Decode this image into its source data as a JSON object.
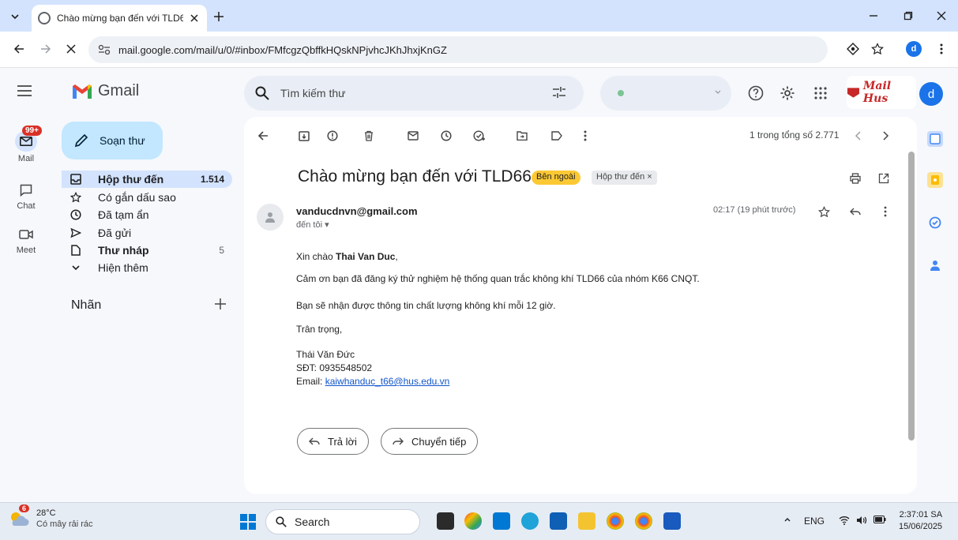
{
  "browser": {
    "tab_title": "Chào mừng bạn đến với TLD66",
    "url": "mail.google.com/mail/u/0/#inbox/FMfcgzQbffkHQskNPjvhcJKhJhxjKnGZ",
    "profile_initial": "d"
  },
  "gmail": {
    "logo_text": "Gmail",
    "search_placeholder": "Tìm kiếm thư",
    "brand_label": "Mail Hus",
    "avatar_initial": "d"
  },
  "rail": {
    "mail_badge": "99+",
    "items": [
      {
        "label": "Mail",
        "icon": "mail-icon"
      },
      {
        "label": "Chat",
        "icon": "chat-icon"
      },
      {
        "label": "Meet",
        "icon": "video-icon"
      }
    ]
  },
  "nav": {
    "compose_label": "Soạn thư",
    "items": [
      {
        "label": "Hộp thư đến",
        "count": "1.514",
        "icon": "inbox-icon"
      },
      {
        "label": "Có gắn dấu sao",
        "count": "",
        "icon": "star-icon"
      },
      {
        "label": "Đã tạm ẩn",
        "count": "",
        "icon": "clock-icon"
      },
      {
        "label": "Đã gửi",
        "count": "",
        "icon": "send-icon"
      },
      {
        "label": "Thư nháp",
        "count": "5",
        "icon": "draft-icon"
      },
      {
        "label": "Hiện thêm",
        "count": "",
        "icon": "chevron-down-icon"
      }
    ],
    "labels_header": "Nhãn"
  },
  "message": {
    "pager": "1 trong tổng số 2.771",
    "subject": "Chào mừng bạn đến với TLD66",
    "chip_outside": "Bên ngoài",
    "chip_inbox": "Hộp thư đến",
    "sender": "vanducdnvn@gmail.com",
    "to_me": "đến tôi",
    "time": "02:17 (19 phút trước)",
    "greeting_prefix": "Xin chào ",
    "greeting_name": "Thai Van Duc",
    "greeting_suffix": ",",
    "line1": "Cảm ơn bạn đã đăng ký thử nghiệm hệ thống quan trắc không khí TLD66 của nhóm K66 CNQT.",
    "line2": "Bạn sẽ nhận được thông tin chất lượng không khí mỗi 12 giờ.",
    "closing": "Trân trọng,",
    "sig_name": "Thái Văn Đức",
    "sig_phone": "SĐT: 0935548502",
    "sig_email_prefix": "Email: ",
    "sig_email": "kaiwhanduc_t66@hus.edu.vn",
    "reply_label": "Trả lời",
    "forward_label": "Chuyển tiếp"
  },
  "taskbar": {
    "weather_badge": "6",
    "temperature": "28°C",
    "weather_desc": "Có mây rải rác",
    "search_label": "Search",
    "lang": "ENG",
    "time": "2:37:01 SA",
    "date": "15/06/2025"
  },
  "colors": {
    "compose": "#c2e7ff",
    "active_nav": "#d3e3fd",
    "chip_outside": "#fcc934",
    "link": "#1155cc"
  }
}
